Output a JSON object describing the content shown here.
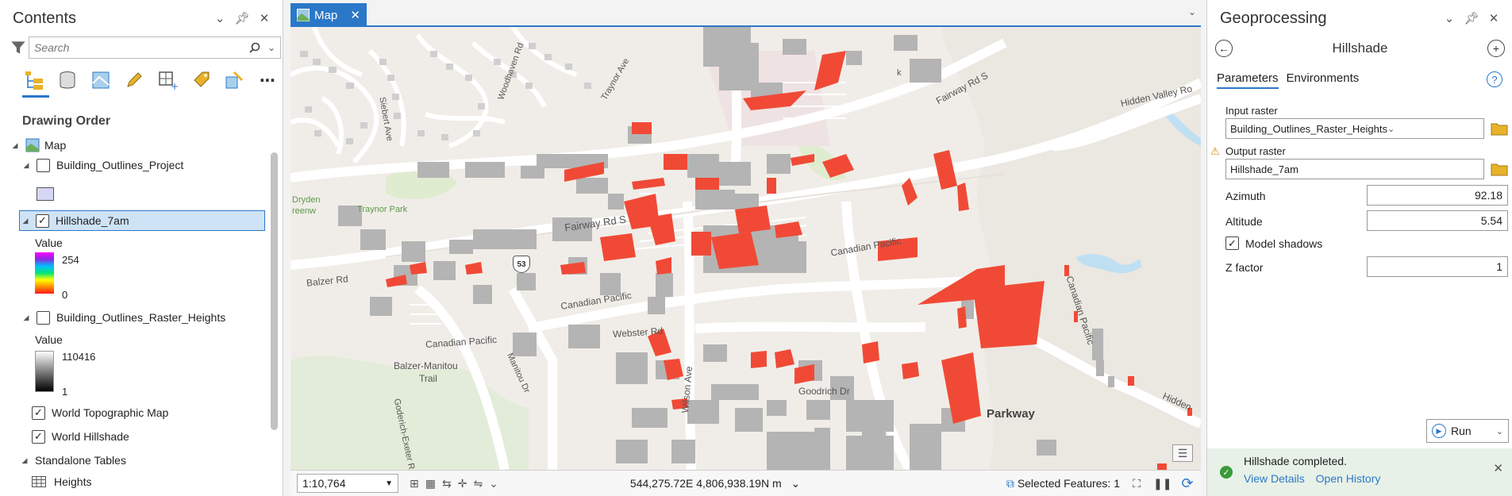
{
  "contents": {
    "title": "Contents",
    "search_placeholder": "Search",
    "drawing_order": "Drawing Order",
    "layers": {
      "map": "Map",
      "building_outlines_project": "Building_Outlines_Project",
      "hillshade": "Hillshade_7am",
      "hillshade_value_label": "Value",
      "hillshade_high": "254",
      "hillshade_low": "0",
      "raster_heights": "Building_Outlines_Raster_Heights",
      "raster_value_label": "Value",
      "raster_high": "110416",
      "raster_low": "1",
      "topo": "World Topographic Map",
      "world_hillshade": "World Hillshade",
      "standalone_tables": "Standalone Tables",
      "heights": "Heights"
    },
    "checked": {
      "building_outlines_project": false,
      "hillshade": true,
      "raster_heights": false,
      "topo": true,
      "world_hillshade": true
    }
  },
  "map": {
    "tab_label": "Map",
    "labels": {
      "fairway_rd_s_1": "Fairway Rd S",
      "fairway_rd_s_2": "Fairway Rd S",
      "canadian_pacific_1": "Canadian Pacific",
      "canadian_pacific_2": "Canadian Pacific",
      "canadian_pacific_3": "Canadian Pacific",
      "canadian_pacific_4": "Canadian Pacific",
      "balzer_rd": "Balzer Rd",
      "webster_rd": "Webster Rd",
      "balzer_manitou": "Balzer-Manitou",
      "trail": "Trail",
      "wilson_ave": "Wilson Ave",
      "goodrich_dr": "Goodrich Dr",
      "parkway": "Parkway",
      "traynor_park": "Traynor Park",
      "dryden": "Dryden",
      "greenway": "reenw",
      "hidden_valley": "Hidden Valley Ro",
      "hidden": "Hidden",
      "woodhaven": "Woodhaven Rd",
      "traynor_ave": "Traynor Ave",
      "siebert": "Siebert Ave",
      "manitou_dr": "Manitou Dr",
      "goderich": "Goderich-Exeter Rd",
      "route_53": "53",
      "park_fragment": "k"
    }
  },
  "status_bar": {
    "scale": "1:10,764",
    "coordinates": "544,275.72E 4,806,938.19N m",
    "selected_features": "Selected Features: 1"
  },
  "geoprocessing": {
    "title": "Geoprocessing",
    "tool_title": "Hillshade",
    "tabs": [
      "Parameters",
      "Environments"
    ],
    "input_raster_label": "Input raster",
    "input_raster_value": "Building_Outlines_Raster_Heights",
    "output_raster_label": "Output raster",
    "output_raster_value": "Hillshade_7am",
    "azimuth_label": "Azimuth",
    "azimuth_value": "92.18",
    "altitude_label": "Altitude",
    "altitude_value": "5.54",
    "model_shadows_label": "Model shadows",
    "model_shadows_checked": true,
    "z_factor_label": "Z factor",
    "z_factor_value": "1",
    "run_label": "Run",
    "status_message": "Hillshade completed.",
    "view_details": "View Details",
    "open_history": "Open History"
  },
  "colors": {
    "accent": "#2b78c9",
    "building_gray": "#b4b4b4",
    "shade_red": "#f04a36",
    "road": "#ffffff",
    "land": "#f0ede8",
    "water": "#bfe0f2"
  }
}
